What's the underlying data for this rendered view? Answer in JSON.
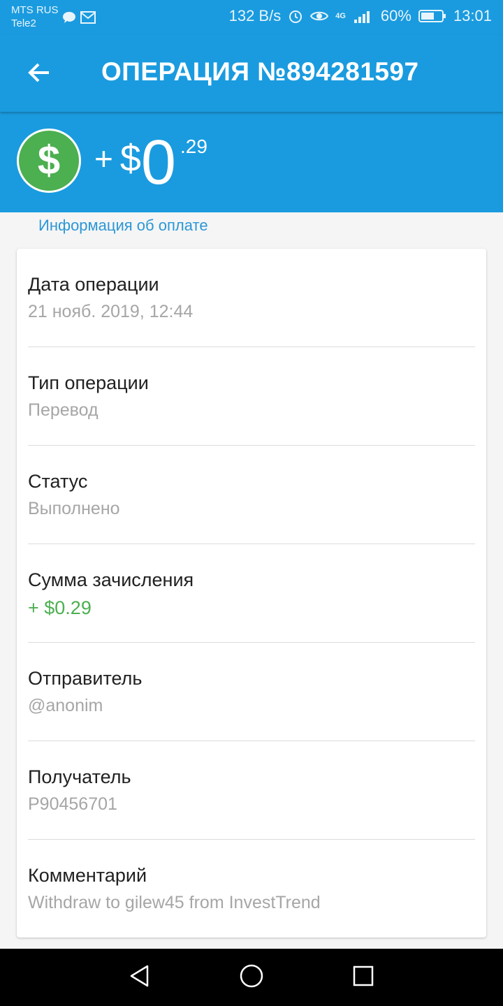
{
  "status_bar": {
    "carrier1": "MTS RUS",
    "carrier2": "Tele2",
    "speed": "132 B/s",
    "network": "4G",
    "battery": "60%",
    "time": "13:01",
    "icons": [
      "chat-icon",
      "message-icon",
      "alarm-icon",
      "eye-icon",
      "signal-icon",
      "battery-icon"
    ]
  },
  "appbar": {
    "title": "ОПЕРАЦИЯ №894281597",
    "back_icon": "arrow-back-icon"
  },
  "amount": {
    "sign": "+",
    "currency": "$",
    "integer": "0",
    "cents": ".29",
    "coin_color": "#4caf50"
  },
  "section_label": "Информация об оплате",
  "details": [
    {
      "label": "Дата операции",
      "value": "21 нояб. 2019, 12:44"
    },
    {
      "label": "Тип операции",
      "value": "Перевод"
    },
    {
      "label": "Статус",
      "value": "Выполнено"
    },
    {
      "label": "Сумма зачисления",
      "value": "+ $0.29"
    },
    {
      "label": "Отправитель",
      "value": "@anonim"
    },
    {
      "label": "Получатель",
      "value": "P90456701"
    },
    {
      "label": "Комментарий",
      "value": "Withdraw to gilew45 from InvestTrend"
    }
  ],
  "colors": {
    "primary": "#1a9bdf",
    "accent_green": "#4caf50",
    "link_blue": "#2b97d6"
  },
  "navbar": {
    "icons": [
      "back-triangle-icon",
      "home-circle-icon",
      "recents-square-icon"
    ]
  }
}
